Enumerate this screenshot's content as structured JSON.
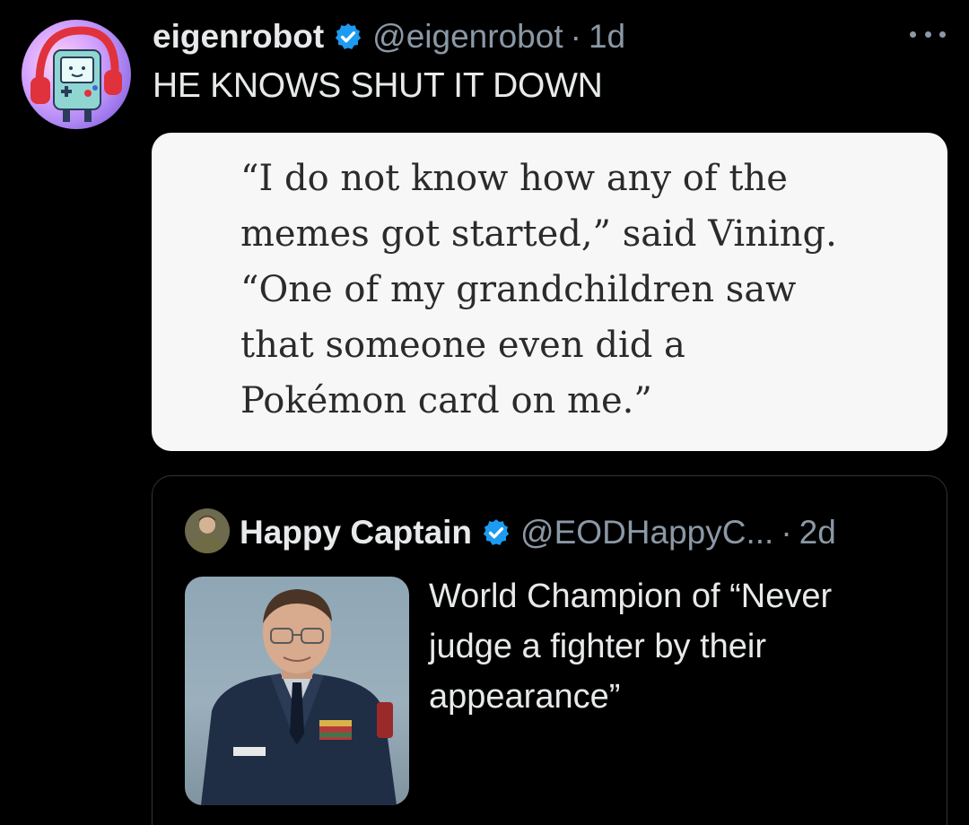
{
  "tweet": {
    "display_name": "eigenrobot",
    "handle": "@eigenrobot",
    "separator": "·",
    "time": "1d",
    "text": "HE KNOWS SHUT IT DOWN"
  },
  "quote_image": {
    "lines": [
      "“I do not know how any of the",
      "memes got started,” said Vining.",
      "“One of my grandchildren saw",
      "that someone even did a",
      "Pokémon card on me.”"
    ]
  },
  "quoted_tweet": {
    "display_name": "Happy Captain",
    "handle": "@EODHappyC...",
    "separator": "·",
    "time": "2d",
    "text": "World Champion of “Never judge a fighter by their appearance”"
  },
  "icons": {
    "verified": "verified-badge-icon",
    "more": "more-options-icon"
  },
  "colors": {
    "background": "#000000",
    "primary_text": "#e7e9ea",
    "secondary_text": "#8b98a5",
    "verified_blue": "#1d9bf0",
    "card_border": "#2f3336",
    "quote_card_bg": "#f7f7f7"
  }
}
